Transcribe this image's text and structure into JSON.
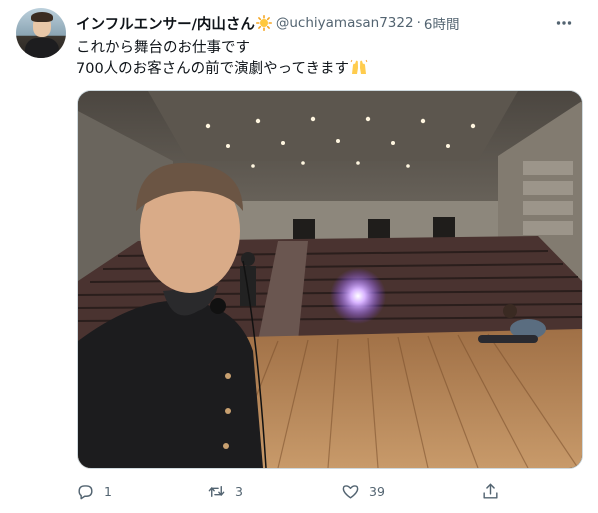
{
  "user": {
    "display_name": "インフルエンサー/内山さん",
    "handle": "@uchiyamasan7322",
    "separator": "·",
    "time": "6時間"
  },
  "tweet": {
    "line1": "これから舞台のお仕事です",
    "line2": "700人のお客さんの前で演劇やってきます"
  },
  "metrics": {
    "replies": "1",
    "retweets": "3",
    "likes": "39"
  },
  "icons": {
    "more": "more-horizontal-icon",
    "reply": "speech-bubble-icon",
    "retweet": "retweet-arrows-icon",
    "like": "heart-icon",
    "share": "upload-arrow-icon",
    "name_emoji": "sun-emoji",
    "text_emoji": "raised-hands-emoji"
  },
  "colors": {
    "text": "#0f1419",
    "secondary": "#536471",
    "border": "#cfd9de"
  }
}
